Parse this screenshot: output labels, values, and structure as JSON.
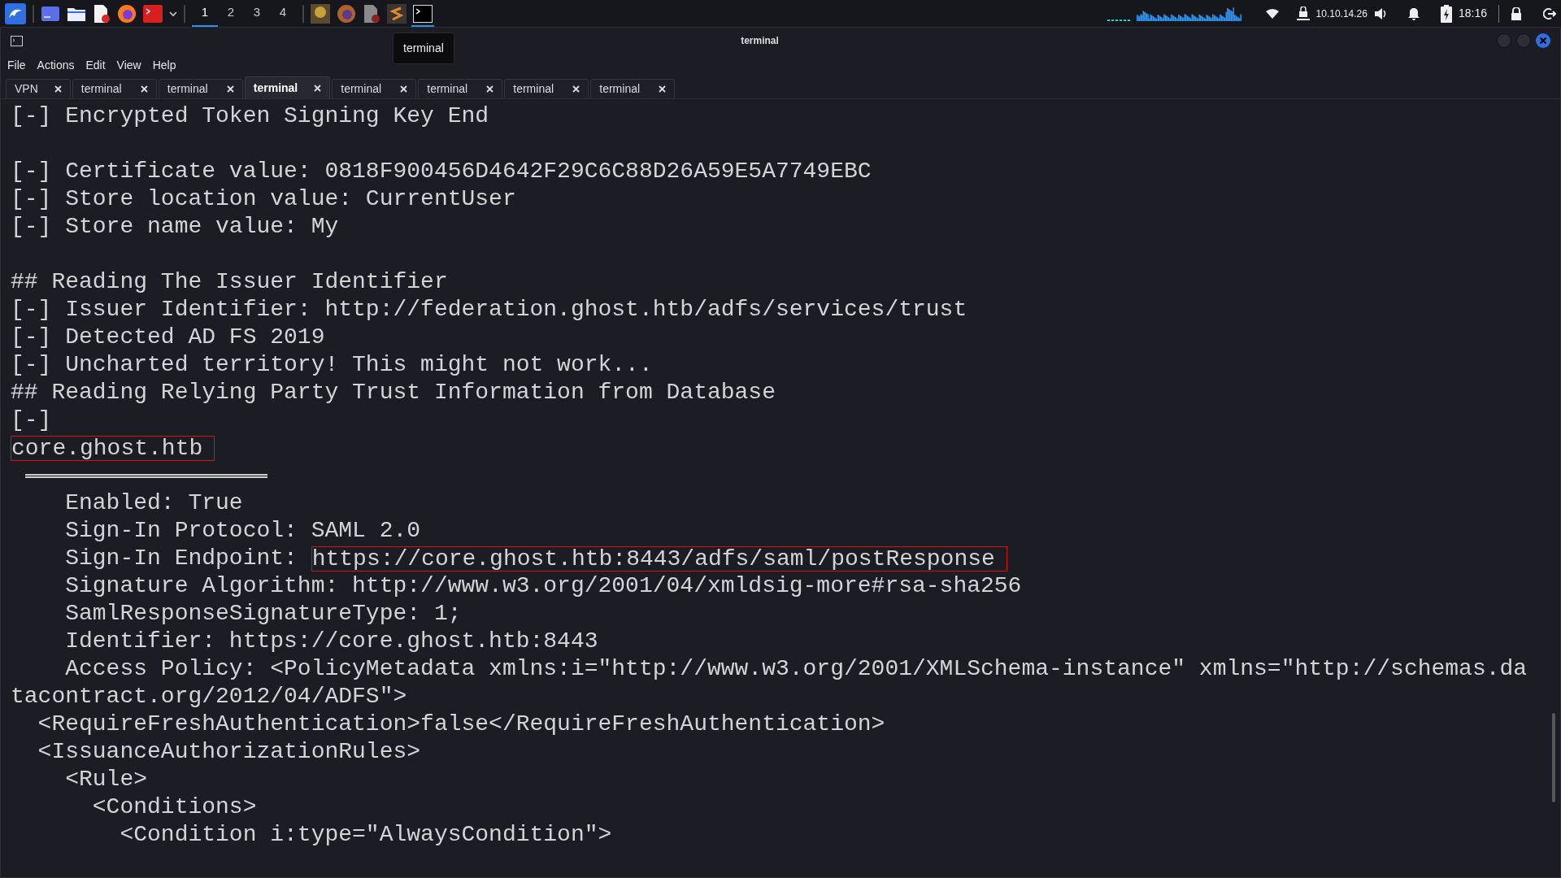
{
  "panel": {
    "workspaces": [
      {
        "label": "1",
        "selected": true
      },
      {
        "label": "2",
        "selected": false
      },
      {
        "label": "3",
        "selected": false
      },
      {
        "label": "4",
        "selected": false
      }
    ],
    "ip": "10.10.14.26",
    "clock": "18:16"
  },
  "window": {
    "title": "terminal",
    "tooltip": "terminal"
  },
  "menu": [
    "File",
    "Actions",
    "Edit",
    "View",
    "Help"
  ],
  "tabs": [
    {
      "label": "VPN",
      "selected": false
    },
    {
      "label": "terminal",
      "selected": false
    },
    {
      "label": "terminal",
      "selected": false
    },
    {
      "label": "terminal",
      "selected": true
    },
    {
      "label": "terminal",
      "selected": false
    },
    {
      "label": "terminal",
      "selected": false
    },
    {
      "label": "terminal",
      "selected": false
    },
    {
      "label": "terminal",
      "selected": false
    }
  ],
  "lines": [
    {
      "kind": "text",
      "segments": [
        {
          "text": "[-] Encrypted Token Signing Key End",
          "boxed": false
        }
      ]
    },
    {
      "kind": "blank"
    },
    {
      "kind": "text",
      "segments": [
        {
          "text": "[-] Certificate value: 0818F900456D4642F29C6C88D26A59E5A7749EBC",
          "boxed": false
        }
      ]
    },
    {
      "kind": "text",
      "segments": [
        {
          "text": "[-] Store location value: CurrentUser",
          "boxed": false
        }
      ]
    },
    {
      "kind": "text",
      "segments": [
        {
          "text": "[-] Store name value: My",
          "boxed": false
        }
      ]
    },
    {
      "kind": "blank"
    },
    {
      "kind": "text",
      "segments": [
        {
          "text": "## Reading The Issuer Identifier",
          "boxed": false
        }
      ]
    },
    {
      "kind": "text",
      "segments": [
        {
          "text": "[-] Issuer Identifier: http://federation.ghost.htb/adfs/services/trust",
          "boxed": false
        }
      ]
    },
    {
      "kind": "text",
      "segments": [
        {
          "text": "[-] Detected AD FS 2019",
          "boxed": false
        }
      ]
    },
    {
      "kind": "text",
      "segments": [
        {
          "text": "[-] Uncharted territory! This might not work...",
          "boxed": false
        }
      ]
    },
    {
      "kind": "text",
      "segments": [
        {
          "text": "## Reading Relying Party Trust Information from Database",
          "boxed": false
        }
      ]
    },
    {
      "kind": "text",
      "segments": [
        {
          "text": "[-]",
          "boxed": false
        }
      ]
    },
    {
      "kind": "text",
      "segments": [
        {
          "text": "core.ghost.htb",
          "boxed": true
        }
      ]
    },
    {
      "kind": "rule"
    },
    {
      "kind": "text",
      "segments": [
        {
          "text": "    Enabled: True",
          "boxed": false
        }
      ]
    },
    {
      "kind": "text",
      "segments": [
        {
          "text": "    Sign-In Protocol: SAML 2.0",
          "boxed": false
        }
      ]
    },
    {
      "kind": "text",
      "segments": [
        {
          "text": "    Sign-In Endpoint: ",
          "boxed": false
        },
        {
          "text": "https://core.ghost.htb:8443/adfs/saml/postResponse",
          "boxed": true
        }
      ]
    },
    {
      "kind": "text",
      "segments": [
        {
          "text": "    Signature Algorithm: http://www.w3.org/2001/04/xmldsig-more#rsa-sha256",
          "boxed": false
        }
      ]
    },
    {
      "kind": "text",
      "segments": [
        {
          "text": "    SamlResponseSignatureType: 1;",
          "boxed": false
        }
      ]
    },
    {
      "kind": "text",
      "segments": [
        {
          "text": "    Identifier: https://core.ghost.htb:8443",
          "boxed": false
        }
      ]
    },
    {
      "kind": "text",
      "segments": [
        {
          "text": "    Access Policy: <PolicyMetadata xmlns:i=\"http://www.w3.org/2001/XMLSchema-instance\" xmlns=\"http://schemas.da",
          "boxed": false
        }
      ]
    },
    {
      "kind": "text",
      "segments": [
        {
          "text": "tacontract.org/2012/04/ADFS\">",
          "boxed": false
        }
      ]
    },
    {
      "kind": "text",
      "segments": [
        {
          "text": "  <RequireFreshAuthentication>false</RequireFreshAuthentication>",
          "boxed": false
        }
      ]
    },
    {
      "kind": "text",
      "segments": [
        {
          "text": "  <IssuanceAuthorizationRules>",
          "boxed": false
        }
      ]
    },
    {
      "kind": "text",
      "segments": [
        {
          "text": "    <Rule>",
          "boxed": false
        }
      ]
    },
    {
      "kind": "text",
      "segments": [
        {
          "text": "      <Conditions>",
          "boxed": false
        }
      ]
    },
    {
      "kind": "text",
      "segments": [
        {
          "text": "        <Condition i:type=\"AlwaysCondition\">",
          "boxed": false
        }
      ]
    }
  ]
}
